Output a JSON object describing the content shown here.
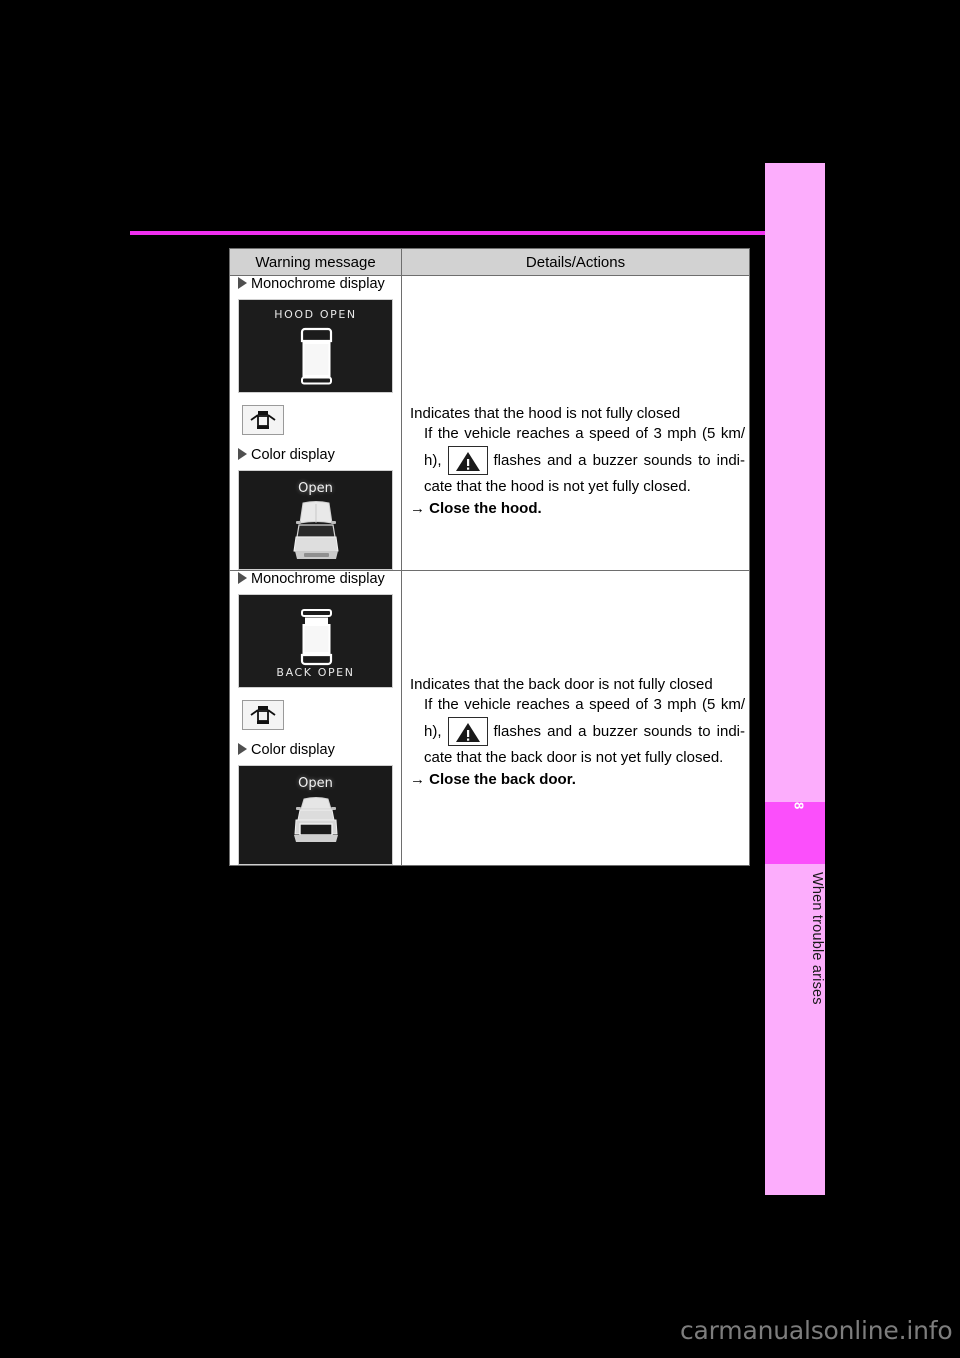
{
  "page": {
    "chapter_number": "8",
    "chapter_title": "When trouble arises",
    "watermark": "carmanualsonline.info"
  },
  "table": {
    "headers": [
      "Warning message",
      "Details/Actions"
    ],
    "rows": [
      {
        "message": {
          "mono_label": "Monochrome display",
          "mono_screen": {
            "text": "HOOD OPEN",
            "text_position": "top",
            "icon": "car-top-view-hood-open-icon"
          },
          "badge_icon": "hood-ajar-indicator-icon",
          "color_label": "Color display",
          "color_screen": {
            "text": "Open",
            "icon": "car-front-view-hood-raised-icon"
          }
        },
        "details": {
          "line1": "Indicates that the hood is not fully closed",
          "line2": "If the vehicle reaches a speed of 3 mph (5 km/",
          "line3_a": "h),",
          "line3_b": "flashes and a buzzer sounds to indi-",
          "warning_icon": "warning-triangle-icon",
          "line4": "cate that the hood is not yet fully closed.",
          "arrow": "→",
          "action": "Close the hood."
        }
      },
      {
        "message": {
          "mono_label": "Monochrome display",
          "mono_screen": {
            "text": "BACK OPEN",
            "text_position": "bottom",
            "icon": "car-top-view-back-door-open-icon"
          },
          "badge_icon": "back-door-ajar-indicator-icon",
          "color_label": "Color display",
          "color_screen": {
            "text": "Open",
            "icon": "car-rear-view-back-door-open-icon"
          }
        },
        "details": {
          "line1": "Indicates that the back door is not fully closed",
          "line2": "If the vehicle reaches a speed of 3 mph (5 km/",
          "line3_a": "h),",
          "line3_b": "flashes and a buzzer sounds to indi-",
          "warning_icon": "warning-triangle-icon",
          "line4": "cate that the back door is not yet fully closed.",
          "arrow": "→",
          "action": "Close the back door."
        }
      }
    ]
  },
  "colors": {
    "accent": "#f02ff0",
    "tab_light": "#fcadfc",
    "tab_dark": "#fb4ffb",
    "header_bg": "#d2d2d2",
    "page_bg": "#000000"
  }
}
